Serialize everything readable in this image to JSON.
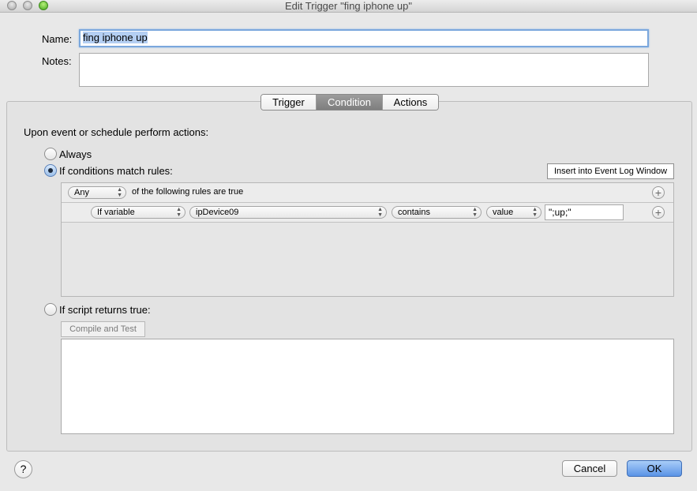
{
  "window": {
    "title": "Edit Trigger \"fing iphone up\""
  },
  "form": {
    "name_label": "Name:",
    "name_value": "fing iphone up",
    "notes_label": "Notes:",
    "notes_value": ""
  },
  "tabs": [
    {
      "label": "Trigger"
    },
    {
      "label": "Condition",
      "selected": true
    },
    {
      "label": "Actions"
    }
  ],
  "condition": {
    "heading": "Upon event or schedule perform actions:",
    "always_label": "Always",
    "match_label": "If conditions match rules:",
    "insert_button": "Insert into Event Log Window",
    "rules": {
      "quantifier": "Any",
      "quantifier_suffix": "of the following rules are true",
      "rule": {
        "type": "If variable",
        "variable": "ipDevice09",
        "operator": "contains",
        "value_mode": "value",
        "value": "\";up;\""
      }
    },
    "script_label": "If script returns true:",
    "compile_button": "Compile and Test",
    "script_text": ""
  },
  "footer": {
    "help": "?",
    "cancel": "Cancel",
    "ok": "OK"
  },
  "colors": {
    "ok_button": "#5a93e6",
    "selected_tab": "#8a8a8a",
    "focus_ring": "#7aa7dd"
  }
}
